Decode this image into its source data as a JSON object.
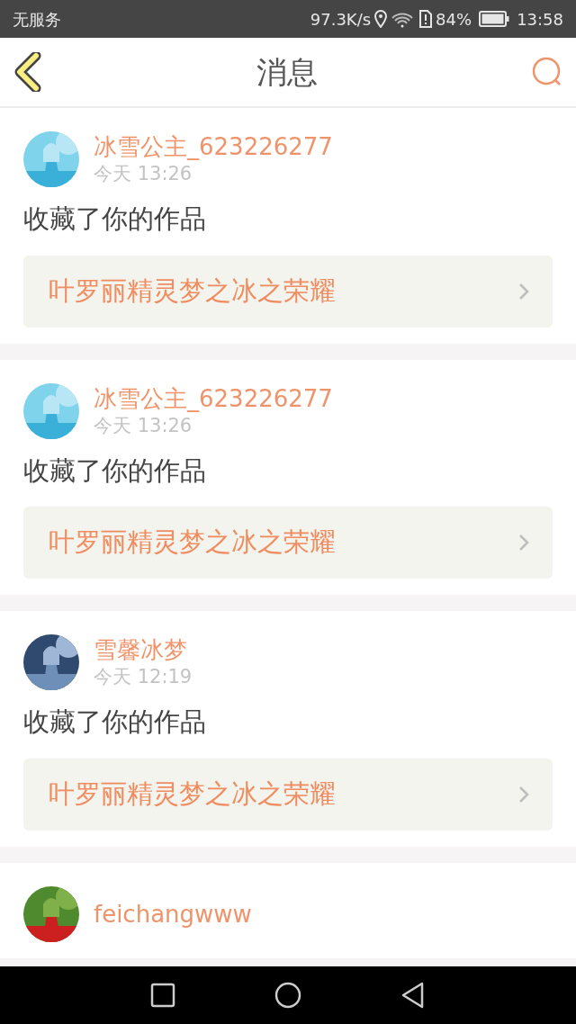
{
  "status_bar": {
    "carrier": "无服务",
    "speed": "97.3K/s",
    "battery": "84%",
    "time": "13:58"
  },
  "header": {
    "title": "消息"
  },
  "messages": [
    {
      "user": "冰雪公主_623226277",
      "time": "今天 13:26",
      "action": "收藏了你的作品",
      "work": "叶罗丽精灵梦之冰之荣耀"
    },
    {
      "user": "冰雪公主_623226277",
      "time": "今天 13:26",
      "action": "收藏了你的作品",
      "work": "叶罗丽精灵梦之冰之荣耀"
    },
    {
      "user": "雪馨冰梦",
      "time": "今天 12:19",
      "action": "收藏了你的作品",
      "work": "叶罗丽精灵梦之冰之荣耀"
    },
    {
      "user": "feichangwww"
    }
  ]
}
